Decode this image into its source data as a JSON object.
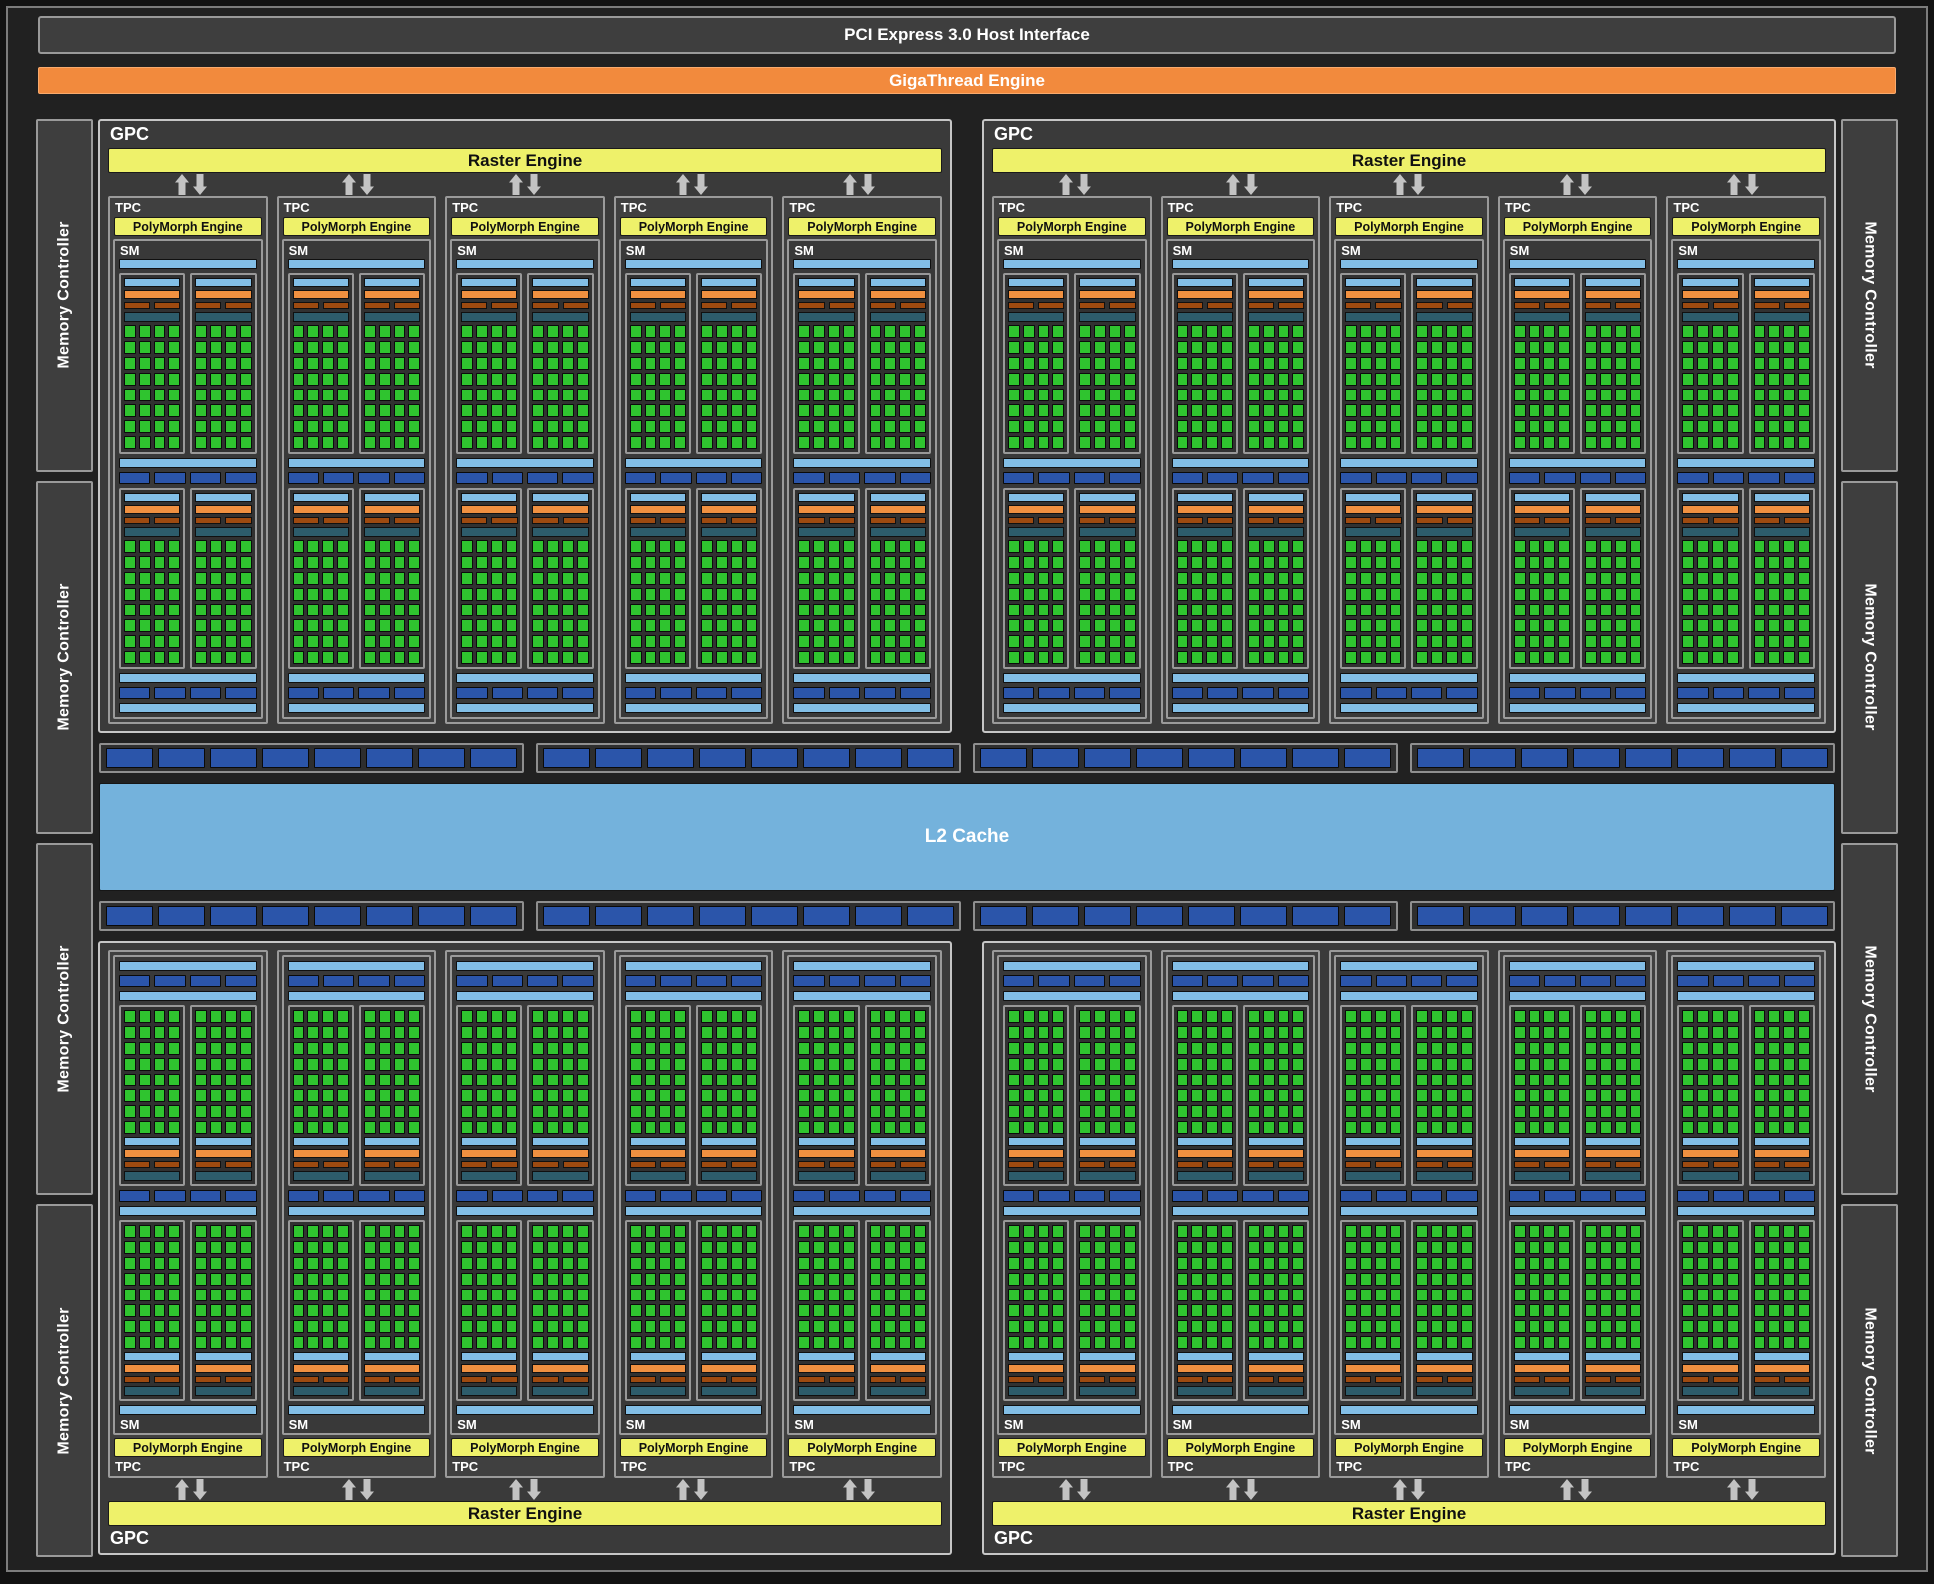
{
  "host_interface_label": "PCI Express 3.0 Host Interface",
  "gigathread_label": "GigaThread Engine",
  "l2_label": "L2 Cache",
  "memory_controller": {
    "label": "Memory Controller",
    "per_side": 4
  },
  "gpc": {
    "label": "GPC",
    "count": 4,
    "top_count": 2,
    "bottom_count": 2,
    "raster_label": "Raster Engine",
    "tpcs_per_gpc": 5,
    "tpc_label": "TPC",
    "polymorph_label": "PolyMorph Engine",
    "sm_label": "SM",
    "sm": {
      "layout": [
        "lbar",
        "partitions",
        "lbar",
        "segments",
        "partitions",
        "lbar",
        "segments",
        "lbar"
      ],
      "partitions_per_row": 2,
      "segments_per_row": 4,
      "partition_bars": [
        "lightblue",
        "orange",
        "brown-pair",
        "teal"
      ],
      "dispatch_bars_per_pair": 2,
      "core_grid": {
        "cols": 4,
        "rows": 8
      }
    }
  },
  "interconnect": {
    "strip_rows": 2,
    "strips_per_row": 4,
    "segments_per_strip": 8
  },
  "icons": {
    "raster_tpc_link": "up-down-arrows-icon"
  },
  "colors": {
    "orange": "#f28a3d",
    "orange2": "#f09040",
    "yellow": "#eef16a",
    "lightblue": "#82bee6",
    "royal": "#2b55aa",
    "brown": "#9e4a10",
    "teal": "#2d5c6b",
    "green": "#2fc42f",
    "l2": "#74b2dc"
  }
}
